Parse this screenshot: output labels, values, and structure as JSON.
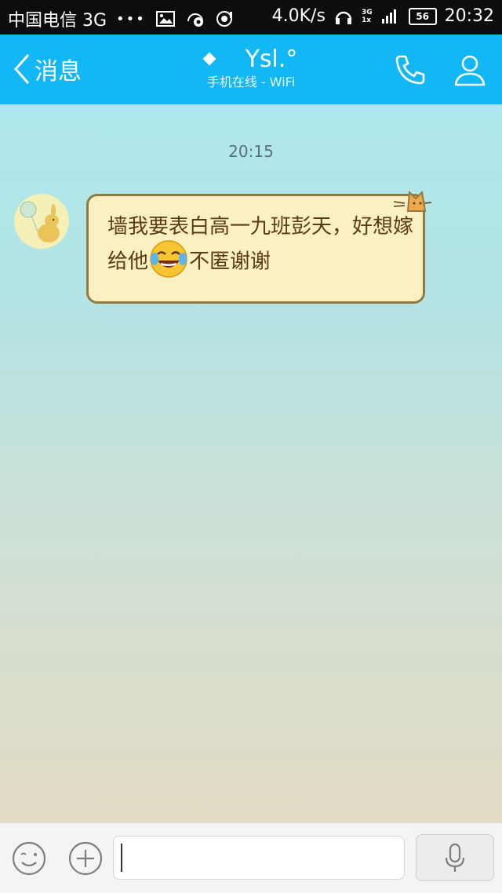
{
  "status_bar": {
    "carrier": "中国电信 3G",
    "dots": "•••",
    "speed": "4.0K/s",
    "network_top": "3G",
    "network_bottom": "1x",
    "battery": "56",
    "time": "20:32"
  },
  "header": {
    "back_label": "消息",
    "contact_name": "Ysl.°",
    "status": "手机在线 - WiFi",
    "accent_color": "#12b7f5"
  },
  "chat": {
    "timestamp": "20:15",
    "messages": [
      {
        "from": "contact",
        "text_part1": "墙我要表白高一九班彭天，好想嫁给他",
        "emoji": "tears-of-joy-emoji",
        "text_part2": "不匿谢谢"
      }
    ]
  },
  "input_bar": {
    "value": "",
    "placeholder": ""
  },
  "icons": {
    "back": "chevron-left-icon",
    "call": "phone-icon",
    "profile": "person-icon",
    "emoji": "smiley-icon",
    "plus": "plus-icon",
    "voice": "microphone-icon"
  }
}
